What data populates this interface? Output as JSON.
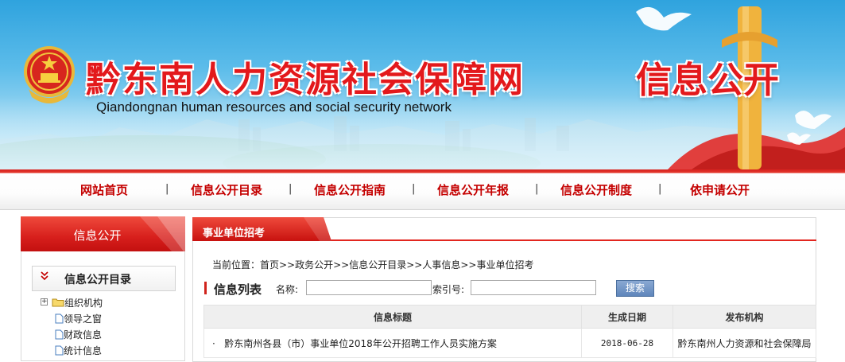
{
  "header": {
    "site_title": "黔东南人力资源社会保障网",
    "site_subtitle": "Qiandongnan  human resources and social security network",
    "section_title": "信息公开"
  },
  "nav": {
    "items": [
      "网站首页",
      "信息公开目录",
      "信息公开指南",
      "信息公开年报",
      "信息公开制度",
      "依申请公开"
    ],
    "separator": "|"
  },
  "sidebar": {
    "title": "信息公开",
    "subtitle": "信息公开目录",
    "tree": [
      {
        "label": "组织机构",
        "type": "folder",
        "expander": "+"
      },
      {
        "label": "领导之窗",
        "type": "page"
      },
      {
        "label": "财政信息",
        "type": "page"
      },
      {
        "label": "统计信息",
        "type": "page"
      }
    ]
  },
  "main": {
    "tab_title": "事业单位招考",
    "breadcrumb": "当前位置：首页>>政务公开>>信息公开目录>>人事信息>>事业单位招考",
    "search": {
      "title": "信息列表",
      "name_label": "名称:",
      "name_value": "",
      "index_label": "索引号:",
      "index_value": "",
      "button": "搜索"
    },
    "table": {
      "columns": [
        "信息标题",
        "生成日期",
        "发布机构"
      ],
      "rows": [
        {
          "bullet": "·",
          "title": "黔东南州各县（市）事业单位2018年公开招聘工作人员实施方案",
          "date": "2018-06-28",
          "org": "黔东南州人力资源和社会保障局"
        }
      ]
    }
  },
  "colors": {
    "brand_red": "#e3191c",
    "nav_text": "#c40000",
    "sky_blue": "#2fa3de",
    "button_blue": "#5f86bb"
  },
  "icons": {
    "emblem": "national-emblem-icon",
    "sidebar_sub": "double-chevron-down-icon",
    "folder": "folder-icon",
    "page": "document-icon"
  }
}
